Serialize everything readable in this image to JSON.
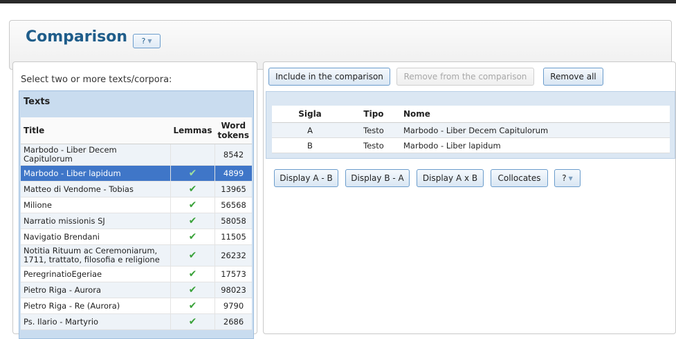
{
  "header": {
    "title": "Comparison",
    "help_label": "?"
  },
  "left": {
    "instruction": "Select two or more texts/corpora:",
    "heading": "Texts",
    "columns": {
      "title": "Title",
      "lemmas": "Lemmas",
      "word_tokens_1": "Word",
      "word_tokens_2": "tokens"
    },
    "rows": [
      {
        "title": "Marbodo - Liber Decem Capitulorum",
        "lemmas": "",
        "tokens": "8542"
      },
      {
        "title": "Marbodo - Liber lapidum",
        "lemmas": "✔",
        "tokens": "4899",
        "selected": true
      },
      {
        "title": "Matteo di Vendome - Tobias",
        "lemmas": "✔",
        "tokens": "13965"
      },
      {
        "title": "Milione",
        "lemmas": "✔",
        "tokens": "56568"
      },
      {
        "title": "Narratio missionis SJ",
        "lemmas": "✔",
        "tokens": "58058"
      },
      {
        "title": "Navigatio Brendani",
        "lemmas": "✔",
        "tokens": "11505"
      },
      {
        "title": "Notitia Rituum ac Ceremoniarum, 1711, trattato, filosofia e religione",
        "lemmas": "✔",
        "tokens": "26232"
      },
      {
        "title": "PeregrinatioEgeriae",
        "lemmas": "✔",
        "tokens": "17573"
      },
      {
        "title": "Pietro Riga - Aurora",
        "lemmas": "✔",
        "tokens": "98023"
      },
      {
        "title": "Pietro Riga - Re (Aurora)",
        "lemmas": "✔",
        "tokens": "9790"
      },
      {
        "title": "Ps. Ilario - Martyrio",
        "lemmas": "✔",
        "tokens": "2686"
      }
    ]
  },
  "right": {
    "include_label": "Include in the comparison",
    "remove_label": "Remove from the comparison",
    "remove_all_label": "Remove all",
    "columns": {
      "sigla": "Sigla",
      "tipo": "Tipo",
      "nome": "Nome"
    },
    "rows": [
      {
        "sigla": "A",
        "tipo": "Testo",
        "nome": "Marbodo - Liber Decem Capitulorum"
      },
      {
        "sigla": "B",
        "tipo": "Testo",
        "nome": "Marbodo - Liber lapidum"
      }
    ],
    "actions": {
      "display_a_b": "Display A - B",
      "display_b_a": "Display B - A",
      "display_axb": "Display A x B",
      "collocates": "Collocates",
      "help": "?"
    }
  },
  "icons": {
    "check": "check-icon",
    "caret": "chevron-down-icon"
  },
  "colors": {
    "accent": "#1f5d8a",
    "selected_row": "#3f76c8",
    "check": "#3aa23a"
  }
}
